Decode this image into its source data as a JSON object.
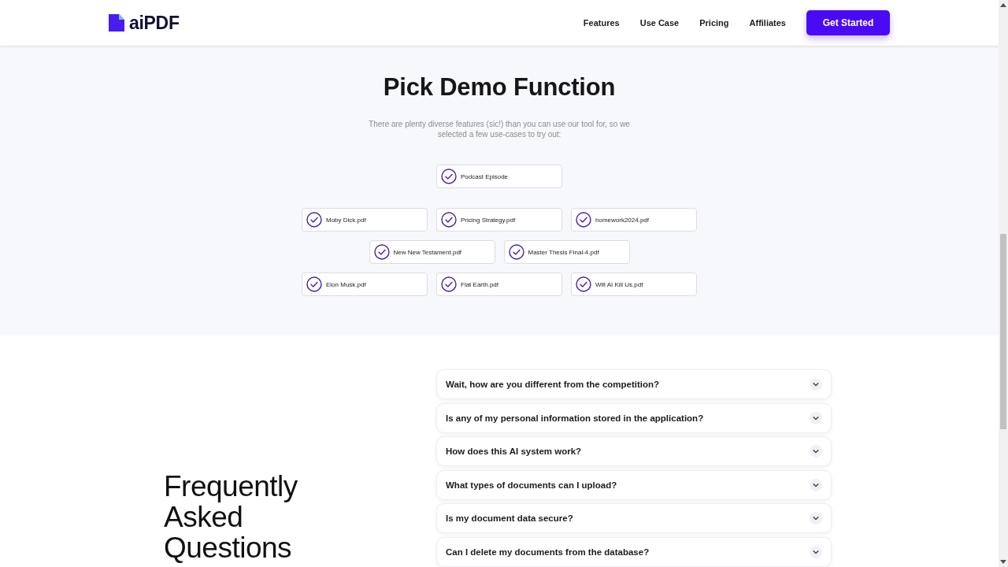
{
  "header": {
    "logo": "aiPDF",
    "nav": [
      "Features",
      "Use Case",
      "Pricing",
      "Affiliates"
    ],
    "cta": "Get Started"
  },
  "demo": {
    "title": "Pick Demo Function",
    "subtitle": "There are plenty diverse features (sic!) than you can use our tool for, so we selected a few use-cases to try out:",
    "featured": {
      "label": "Podcast Episode",
      "checked": true
    },
    "files": [
      {
        "label": "Moby Dick.pdf",
        "checked": true
      },
      {
        "label": "Pricing Strategy.pdf",
        "checked": true
      },
      {
        "label": "homework2024.pdf",
        "checked": true
      },
      {
        "label": "New New Testament.pdf",
        "checked": true
      },
      {
        "label": "Master Thesis Final-4.pdf",
        "checked": true
      },
      {
        "label": "Elon Musk.pdf",
        "checked": true
      },
      {
        "label": "Flat Earth.pdf",
        "checked": true
      },
      {
        "label": "Will AI Kill Us.pdf",
        "checked": true
      }
    ]
  },
  "faq": {
    "title": "Frequently Asked Questions",
    "items": [
      {
        "question": "Wait, how are you different from the competition?",
        "expanded": false
      },
      {
        "question": "Is any of my personal information stored in the application?",
        "expanded": false
      },
      {
        "question": "How does this AI system work?",
        "expanded": false
      },
      {
        "question": "What types of documents can I upload?",
        "expanded": false
      },
      {
        "question": "Is my document data secure?",
        "expanded": false
      },
      {
        "question": "Can I delete my documents from the database?",
        "expanded": false
      }
    ]
  }
}
